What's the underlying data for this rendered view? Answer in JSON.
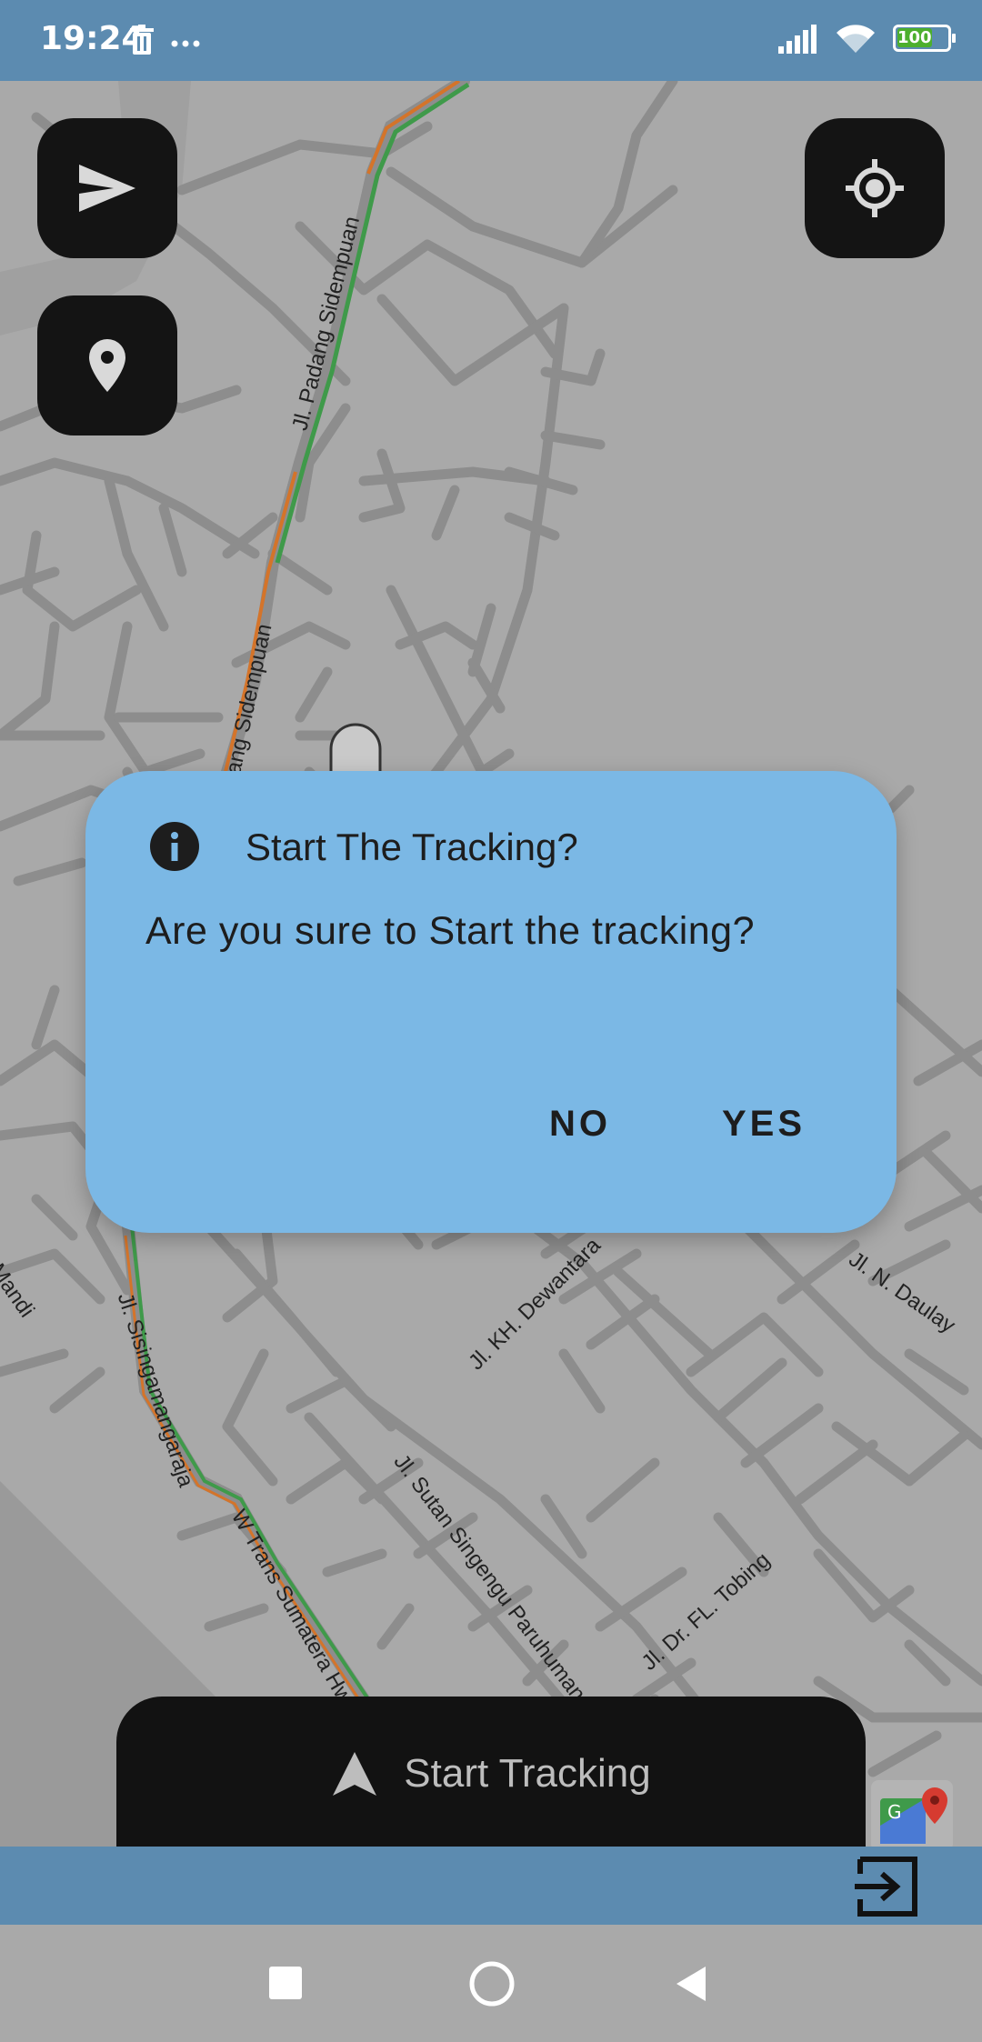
{
  "status_bar": {
    "time": "19:24",
    "left_icons": [
      "trash-icon",
      "more-dots-icon"
    ],
    "right_icons": [
      "signal-icon",
      "wifi-icon",
      "battery-icon"
    ],
    "battery_level": "100"
  },
  "map": {
    "streets": [
      "Jl. Padang Sidempuan",
      "Padang Sidempuan",
      "Jl. Sisingamangaraja",
      "W Trans Sumatera Hwy",
      "Jl. KH. Dewantara",
      "Jl. N. Daulay",
      "Jl. Sutan Singengu Paruhuman",
      "Jl. Dr. FL. Tobing",
      "Mandi"
    ],
    "colors": {
      "road": "#8a8a8a",
      "traffic_green": "#3f9a4a",
      "traffic_orange": "#d4742a"
    }
  },
  "fabs": {
    "navigate": "send-icon",
    "marker": "location-pin-icon",
    "my_location": "crosshair-icon"
  },
  "dialog": {
    "title": "Start The Tracking?",
    "message": "Are you sure to Start the tracking?",
    "no_label": "NO",
    "yes_label": "YES",
    "background": "#7bb8e5"
  },
  "start_button": {
    "label": "Start Tracking"
  },
  "bottom_bar": {
    "exit_icon": "exit-icon"
  },
  "nav_bar": {
    "items": [
      "recent-apps-icon",
      "home-icon",
      "back-icon"
    ]
  }
}
